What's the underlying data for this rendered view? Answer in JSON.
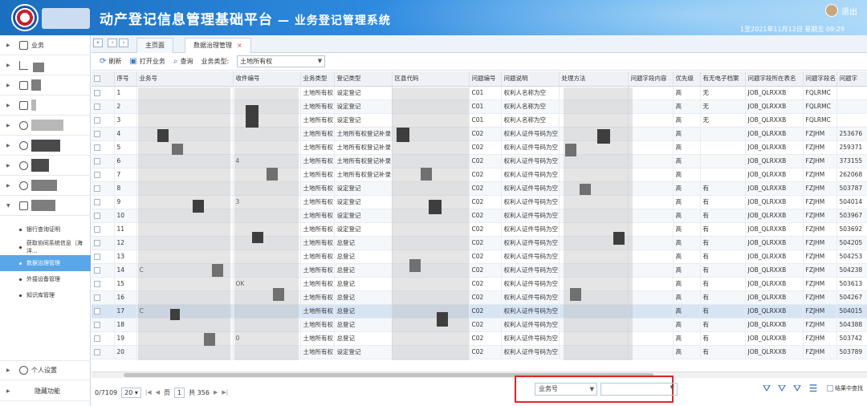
{
  "header": {
    "title": "动产登记信息管理基础平台",
    "subtitle": "— 业务登记管理系统",
    "user_label": "退出",
    "datetime": "1至2021年11月12日 星期五 09:29"
  },
  "sidebar": {
    "items": [
      {
        "label": "业务",
        "icon": "document-icon"
      },
      {
        "label": "",
        "icon": "bar-chart-icon"
      },
      {
        "label": "",
        "icon": "list-icon"
      },
      {
        "label": "",
        "icon": "clipboard-icon"
      },
      {
        "label": "",
        "icon": "refresh-icon"
      },
      {
        "label": "",
        "icon": "refresh-icon"
      },
      {
        "label": "",
        "icon": "refresh-icon"
      },
      {
        "label": "",
        "icon": "globe-icon"
      },
      {
        "label": "",
        "icon": "tool-icon"
      }
    ],
    "sub_items": [
      "银行查询证明",
      "获取协同系统信息（海洋...",
      "数据治理管理",
      "外接设备管理",
      "知识库管理"
    ],
    "active_sub": 2,
    "bottom": {
      "personal": "个人设置",
      "hidden": "隐藏功能"
    }
  },
  "tabs": [
    {
      "label": "主页面"
    },
    {
      "label": "数据治理管理",
      "close": "×"
    }
  ],
  "toolbar": {
    "refresh": "刷新",
    "open": "打开业务",
    "query": "查询",
    "type_label": "业务类型:",
    "type_value": "土地所有权"
  },
  "table": {
    "columns": [
      "序号",
      "业务号",
      "收件编号",
      "业务类型",
      "登记类型",
      "区县代码",
      "问题编号",
      "问题说明",
      "处理方法",
      "问题字段内容",
      "优先级",
      "有无电子档案",
      "问题字段所在表名",
      "问题字段名",
      "问题字"
    ],
    "rows": [
      [
        "1",
        "",
        "",
        "土地所有权",
        "设定登记",
        "",
        "C01",
        "权利人名称为空",
        "",
        "",
        "高",
        "无",
        "JOB_QLRXXB",
        "FQLRMC",
        ""
      ],
      [
        "2",
        "",
        "",
        "土地所有权",
        "设定登记",
        "",
        "C01",
        "权利人名称为空",
        "",
        "",
        "高",
        "无",
        "JOB_QLRXXB",
        "FQLRMC",
        ""
      ],
      [
        "3",
        "",
        "",
        "土地所有权",
        "设定登记",
        "",
        "C01",
        "权利人名称为空",
        "",
        "",
        "高",
        "无",
        "JOB_QLRXXB",
        "FQLRMC",
        ""
      ],
      [
        "4",
        "",
        "",
        "土地所有权",
        "土地所有权登记补录",
        "",
        "C02",
        "权利人证件号码为空",
        "",
        "",
        "高",
        "",
        "JOB_QLRXXB",
        "FZJHM",
        "253676"
      ],
      [
        "5",
        "",
        "",
        "土地所有权",
        "土地所有权登记补录",
        "",
        "C02",
        "权利人证件号码为空",
        "",
        "",
        "高",
        "",
        "JOB_QLRXXB",
        "FZJHM",
        "259371"
      ],
      [
        "6",
        "",
        "4",
        "土地所有权",
        "土地所有权登记补录",
        "",
        "C02",
        "权利人证件号码为空",
        "",
        "",
        "高",
        "",
        "JOB_QLRXXB",
        "FZJHM",
        "373155"
      ],
      [
        "7",
        "",
        "",
        "土地所有权",
        "土地所有权登记补录",
        "",
        "C02",
        "权利人证件号码为空",
        "",
        "",
        "高",
        "",
        "JOB_QLRXXB",
        "FZJHM",
        "262068"
      ],
      [
        "8",
        "",
        "",
        "土地所有权",
        "设定登记",
        "",
        "C02",
        "权利人证件号码为空",
        "",
        "",
        "高",
        "有",
        "JOB_QLRXXB",
        "FZJHM",
        "503787"
      ],
      [
        "9",
        "",
        "3",
        "土地所有权",
        "设定登记",
        "",
        "C02",
        "权利人证件号码为空",
        "",
        "",
        "高",
        "有",
        "JOB_QLRXXB",
        "FZJHM",
        "504014"
      ],
      [
        "10",
        "",
        "",
        "土地所有权",
        "设定登记",
        "",
        "C02",
        "权利人证件号码为空",
        "",
        "",
        "高",
        "有",
        "JOB_QLRXXB",
        "FZJHM",
        "503967"
      ],
      [
        "11",
        "",
        "",
        "土地所有权",
        "设定登记",
        "",
        "C02",
        "权利人证件号码为空",
        "",
        "",
        "高",
        "有",
        "JOB_QLRXXB",
        "FZJHM",
        "503692"
      ],
      [
        "12",
        "",
        "",
        "土地所有权",
        "总登记",
        "",
        "C02",
        "权利人证件号码为空",
        "",
        "",
        "高",
        "有",
        "JOB_QLRXXB",
        "FZJHM",
        "504205"
      ],
      [
        "13",
        "",
        "",
        "土地所有权",
        "总登记",
        "",
        "C02",
        "权利人证件号码为空",
        "",
        "",
        "高",
        "有",
        "JOB_QLRXXB",
        "FZJHM",
        "504253"
      ],
      [
        "14",
        "C",
        "",
        "土地所有权",
        "总登记",
        "",
        "C02",
        "权利人证件号码为空",
        "",
        "",
        "高",
        "有",
        "JOB_QLRXXB",
        "FZJHM",
        "504238"
      ],
      [
        "15",
        "",
        "OK",
        "土地所有权",
        "总登记",
        "",
        "C02",
        "权利人证件号码为空",
        "",
        "",
        "高",
        "有",
        "JOB_QLRXXB",
        "FZJHM",
        "503613"
      ],
      [
        "16",
        "",
        "",
        "土地所有权",
        "总登记",
        "",
        "C02",
        "权利人证件号码为空",
        "",
        "",
        "高",
        "有",
        "JOB_QLRXXB",
        "FZJHM",
        "504267"
      ],
      [
        "17",
        "C",
        "",
        "土地所有权",
        "总登记",
        "",
        "C02",
        "权利人证件号码为空",
        "",
        "",
        "高",
        "有",
        "JOB_QLRXXB",
        "FZJHM",
        "504015"
      ],
      [
        "18",
        "",
        "",
        "土地所有权",
        "总登记",
        "",
        "C02",
        "权利人证件号码为空",
        "",
        "",
        "高",
        "有",
        "JOB_QLRXXB",
        "FZJHM",
        "504388"
      ],
      [
        "19",
        "",
        "0",
        "土地所有权",
        "总登记",
        "",
        "C02",
        "权利人证件号码为空",
        "",
        "",
        "高",
        "有",
        "JOB_QLRXXB",
        "FZJHM",
        "503742"
      ],
      [
        "20",
        "",
        "",
        "土地所有权",
        "设定登记",
        "",
        "C02",
        "权利人证件号码为空",
        "",
        "",
        "高",
        "有",
        "JOB_QLRXXB",
        "FZJHM",
        "503789"
      ]
    ],
    "selected_row": 16
  },
  "footer": {
    "count": "0/7109",
    "page_size": "20",
    "page_label": "页",
    "page_value": "1",
    "total_label": "共 356",
    "field_select": "业务号",
    "field_input": "",
    "result_label": "结果中查找"
  }
}
